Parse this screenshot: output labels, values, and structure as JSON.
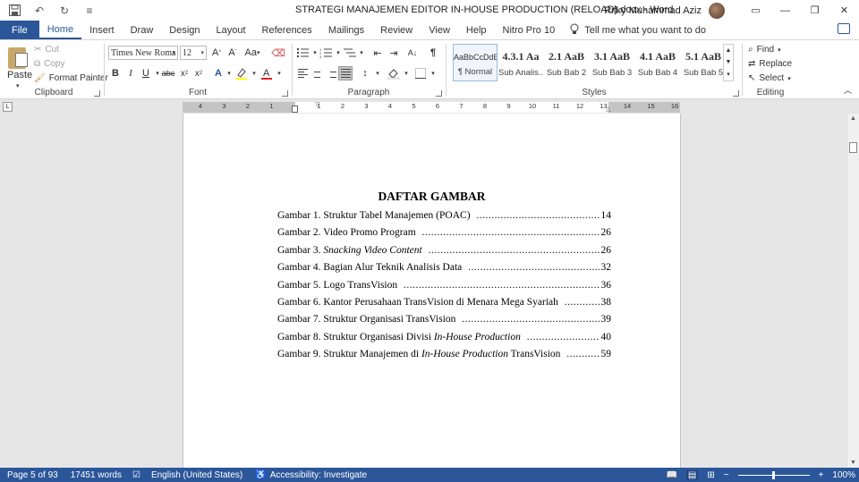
{
  "titlebar": {
    "title": "STRATEGI MANAJEMEN EDITOR IN-HOUSE PRODUCTION (RELOAD).docx  -  Word",
    "user": "Rifky Muhammad Aziz"
  },
  "tabs": [
    "File",
    "Home",
    "Insert",
    "Draw",
    "Design",
    "Layout",
    "References",
    "Mailings",
    "Review",
    "View",
    "Help",
    "Nitro Pro 10"
  ],
  "tell_me": "Tell me what you want to do",
  "clipboard": {
    "paste": "Paste",
    "cut": "Cut",
    "copy": "Copy",
    "format_painter": "Format Painter",
    "label": "Clipboard"
  },
  "font": {
    "name": "Times New Roma",
    "size": "12",
    "label": "Font",
    "case": "Aa"
  },
  "paragraph": {
    "label": "Paragraph"
  },
  "styles": {
    "label": "Styles",
    "items": [
      {
        "preview": "AaBbCcDdE",
        "name": "¶ Normal"
      },
      {
        "preview": "4.3.1  Aa",
        "name": "Sub Analis..."
      },
      {
        "preview": "2.1  AaB",
        "name": "Sub Bab 2"
      },
      {
        "preview": "3.1  AaB",
        "name": "Sub Bab 3"
      },
      {
        "preview": "4.1  AaB",
        "name": "Sub Bab 4"
      },
      {
        "preview": "5.1  AaB",
        "name": "Sub Bab 5"
      }
    ]
  },
  "editing": {
    "find": "Find",
    "replace": "Replace",
    "select": "Select",
    "label": "Editing"
  },
  "ruler": {
    "left_labels": [
      "4",
      "3",
      "2",
      "1"
    ],
    "right_labels": [
      "1",
      "2",
      "3",
      "4",
      "5",
      "6",
      "7",
      "8",
      "9",
      "10",
      "11",
      "12",
      "13",
      "14",
      "15",
      "16"
    ]
  },
  "document": {
    "title": "DAFTAR GAMBAR",
    "entries": [
      {
        "prefix": "Gambar 1. Struktur Tabel Manajemen (POAC) ",
        "italic": "",
        "suffix": "",
        "page": "14"
      },
      {
        "prefix": "Gambar 2. Video Promo Program ",
        "italic": "",
        "suffix": "",
        "page": "26"
      },
      {
        "prefix": "Gambar 3. ",
        "italic": "Snacking Video Content",
        "suffix": " ",
        "page": "26"
      },
      {
        "prefix": "Gambar 4. Bagian Alur Teknik Analisis Data ",
        "italic": "",
        "suffix": "",
        "page": "32"
      },
      {
        "prefix": "Gambar 5. Logo TransVision ",
        "italic": "",
        "suffix": "",
        "page": "36"
      },
      {
        "prefix": "Gambar 6. Kantor Perusahaan TransVision di Menara Mega Syariah ",
        "italic": "",
        "suffix": "",
        "page": "38"
      },
      {
        "prefix": "Gambar 7. Struktur Organisasi TransVision ",
        "italic": "",
        "suffix": "",
        "page": "39"
      },
      {
        "prefix": "Gambar 8. Struktur Organisasi Divisi ",
        "italic": "In-House Production",
        "suffix": " ",
        "page": "40"
      },
      {
        "prefix": "Gambar 9. Struktur Manajemen di ",
        "italic": "In-House Production",
        "suffix": " TransVision ",
        "page": "59"
      }
    ]
  },
  "status": {
    "page": "Page 5 of 93",
    "words": "17451 words",
    "language": "English (United States)",
    "accessibility": "Accessibility: Investigate",
    "zoom": "100%"
  },
  "colors": {
    "accent": "#2b579a"
  }
}
